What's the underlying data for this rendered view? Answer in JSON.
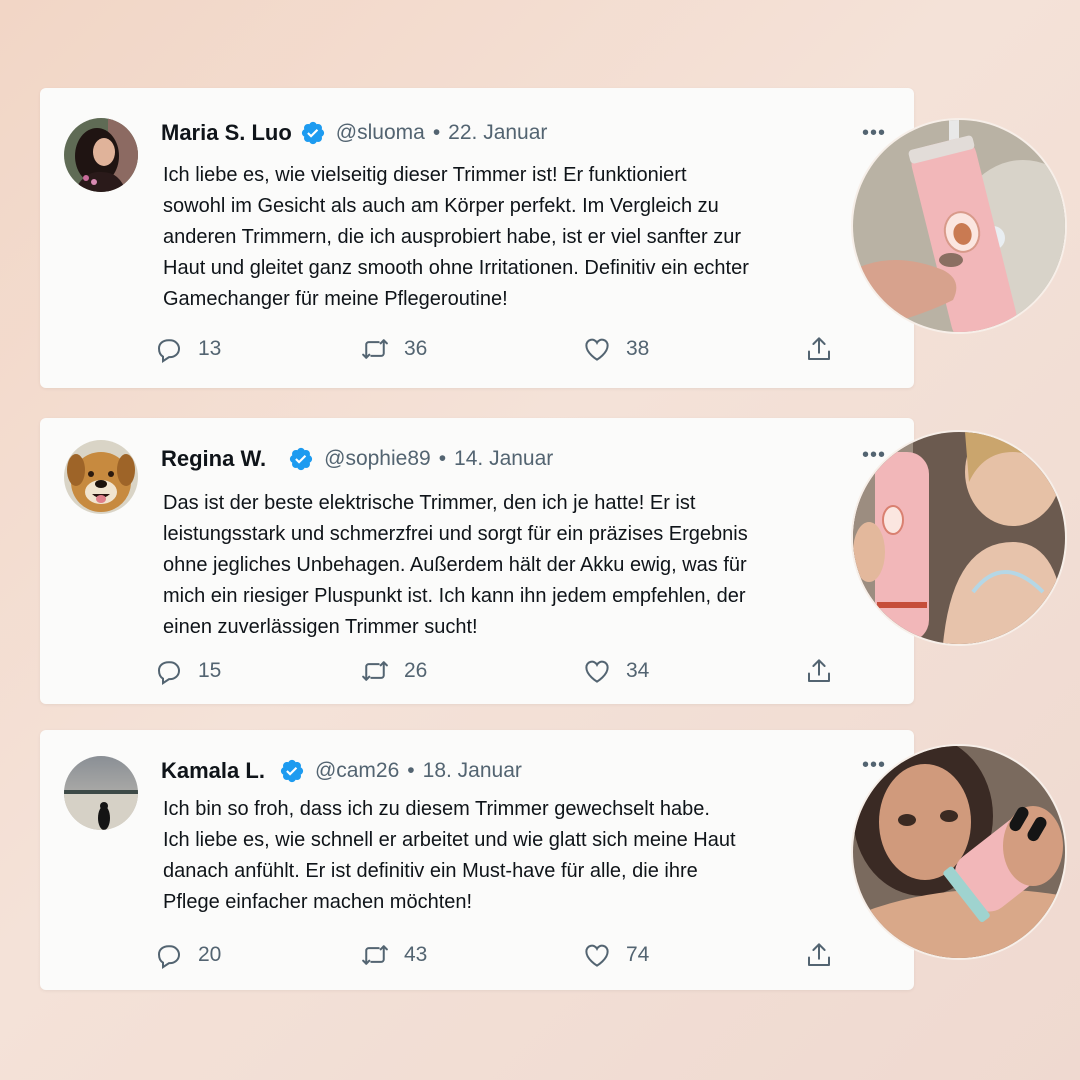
{
  "tweets": [
    {
      "name": "Maria S. Luo",
      "handle": "@sluoma",
      "separator": "•",
      "date": "22. Januar",
      "text_lines": [
        "Ich liebe es, wie vielseitig dieser Trimmer ist! Er funktioniert",
        "sowohl im Gesicht als auch am Körper perfekt. Im Vergleich zu",
        "anderen Trimmern, die ich ausprobiert habe, ist er viel sanfter zur",
        "Haut und gleitet ganz smooth ohne Irritationen. Definitiv ein echter",
        "Gamechanger für meine Pflegeroutine!"
      ],
      "replies": "13",
      "retweets": "36",
      "likes": "38",
      "more": "•••"
    },
    {
      "name": "Regina W.",
      "handle": "@sophie89",
      "separator": "•",
      "date": "14. Januar",
      "text_lines": [
        "Das ist der beste elektrische Trimmer, den ich je hatte! Er ist",
        "leistungsstark und schmerzfrei und sorgt für ein präzises Ergebnis",
        "ohne jegliches Unbehagen. Außerdem hält der Akku ewig, was für",
        "mich ein riesiger Pluspunkt ist. Ich kann ihn jedem empfehlen, der",
        "einen zuverlässigen Trimmer sucht!"
      ],
      "replies": "15",
      "retweets": "26",
      "likes": "34",
      "more": "•••"
    },
    {
      "name": "Kamala L.",
      "handle": "@cam26",
      "separator": "•",
      "date": "18. Januar",
      "text_lines": [
        "Ich bin so froh, dass ich zu diesem Trimmer gewechselt habe.",
        "Ich liebe es, wie schnell er arbeitet und wie glatt sich meine Haut",
        "danach anfühlt. Er ist definitiv ein Must-have für alle, die ihre",
        "Pflege einfacher machen möchten!"
      ],
      "replies": "20",
      "retweets": "43",
      "likes": "74",
      "more": "•••"
    }
  ],
  "icons": {
    "verified": "verified-badge-icon",
    "reply": "reply-bubble-icon",
    "retweet": "retweet-icon",
    "like": "heart-icon",
    "share": "share-icon",
    "more": "more-dots-icon"
  },
  "colors": {
    "verified_blue": "#1d9bf0",
    "text_primary": "#0f1419",
    "text_secondary": "#536471",
    "card_bg": "#fbfbfa",
    "trimmer_pink": "#f2b7b9"
  }
}
